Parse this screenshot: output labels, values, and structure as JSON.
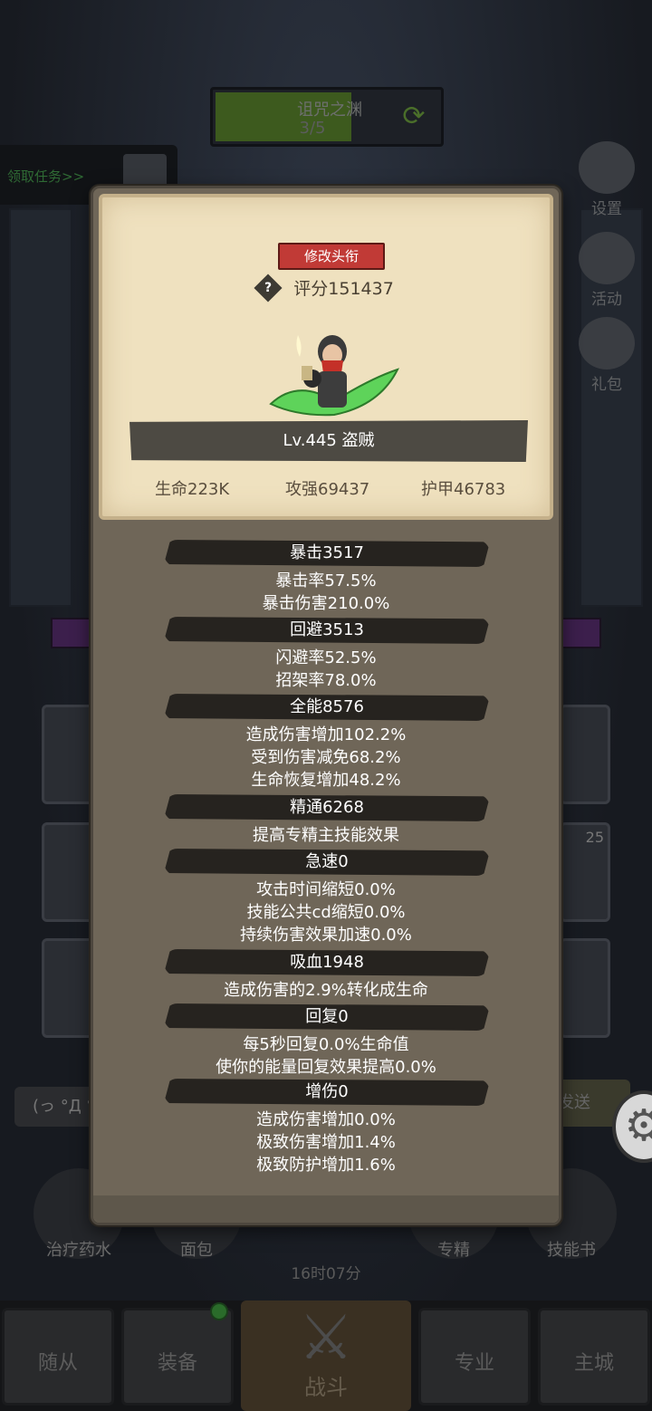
{
  "background": {
    "zone": {
      "name": "诅咒之渊",
      "progress": "3/5"
    },
    "quest_button": "领取任务>>",
    "side_buttons": [
      {
        "label": "设置",
        "icon": "gear-icon"
      },
      {
        "label": "活动",
        "icon": "calendar-icon"
      },
      {
        "label": "礼包",
        "icon": "gift-icon"
      }
    ],
    "chat_placeholder": "(っ °Д °",
    "send_label": "发送",
    "slot_badge": "25",
    "tools": [
      {
        "label": "治疗药水"
      },
      {
        "label": "面包"
      },
      {
        "label": "专精"
      },
      {
        "label": "技能书"
      }
    ],
    "timer": "16时07分",
    "nav": [
      {
        "label": "随从"
      },
      {
        "label": "装备"
      },
      {
        "label": "战斗"
      },
      {
        "label": "专业"
      },
      {
        "label": "主城"
      }
    ]
  },
  "profile": {
    "change_title_button": "修改头衔",
    "score": "评分151437",
    "level_class": "Lv.445 盗贼",
    "hp": "生命223K",
    "attack": "攻强69437",
    "armor": "护甲46783"
  },
  "stats": [
    {
      "header": "暴击3517",
      "lines": [
        "暴击率57.5%",
        "暴击伤害210.0%"
      ]
    },
    {
      "header": "回避3513",
      "lines": [
        "闪避率52.5%",
        "招架率78.0%"
      ]
    },
    {
      "header": "全能8576",
      "lines": [
        "造成伤害增加102.2%",
        "受到伤害减免68.2%",
        "生命恢复增加48.2%"
      ]
    },
    {
      "header": "精通6268",
      "lines": [
        "提高专精主技能效果"
      ]
    },
    {
      "header": "急速0",
      "lines": [
        "攻击时间缩短0.0%",
        "技能公共cd缩短0.0%",
        "持续伤害效果加速0.0%"
      ]
    },
    {
      "header": "吸血1948",
      "lines": [
        "造成伤害的2.9%转化成生命"
      ]
    },
    {
      "header": "回复0",
      "lines": [
        "每5秒回复0.0%生命值",
        "使你的能量回复效果提高0.0%"
      ]
    },
    {
      "header": "增伤0",
      "lines": [
        "造成伤害增加0.0%",
        "极致伤害增加1.4%",
        "极致防护增加1.6%"
      ]
    }
  ]
}
